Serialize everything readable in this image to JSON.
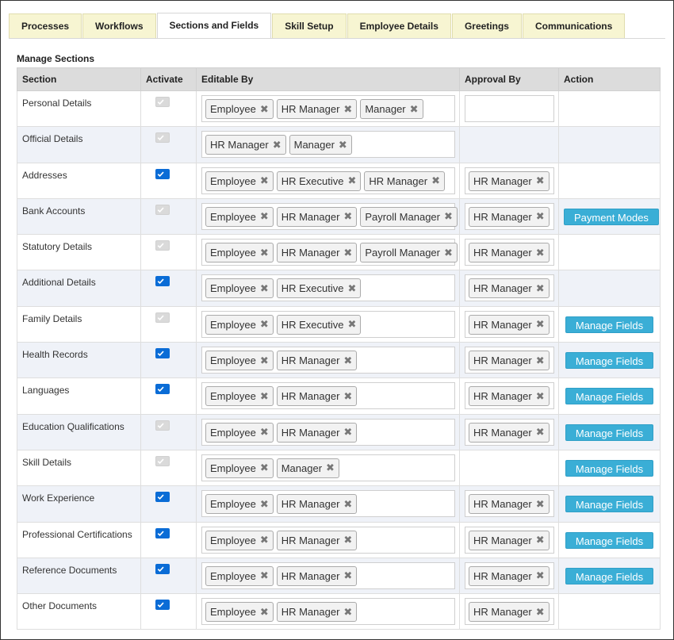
{
  "tabs": [
    {
      "label": "Processes",
      "active": false
    },
    {
      "label": "Workflows",
      "active": false
    },
    {
      "label": "Sections and Fields",
      "active": true
    },
    {
      "label": "Skill Setup",
      "active": false
    },
    {
      "label": "Employee Details",
      "active": false
    },
    {
      "label": "Greetings",
      "active": false
    },
    {
      "label": "Communications",
      "active": false
    }
  ],
  "manage_title": "Manage Sections",
  "columns": {
    "section": "Section",
    "activate": "Activate",
    "editable_by": "Editable By",
    "approval_by": "Approval By",
    "action": "Action"
  },
  "remove_glyph": "✖",
  "rows": [
    {
      "section": "Personal Details",
      "activate": "disabled",
      "editable_by": [
        "Employee",
        "HR Manager",
        "Manager"
      ],
      "approval_box": true,
      "approval_by": [],
      "action": ""
    },
    {
      "section": "Official Details",
      "activate": "disabled",
      "editable_by": [
        "HR Manager",
        "Manager"
      ],
      "approval_box": false,
      "approval_by": [],
      "action": ""
    },
    {
      "section": "Addresses",
      "activate": "checked",
      "editable_by": [
        "Employee",
        "HR Executive",
        "HR Manager"
      ],
      "approval_box": true,
      "approval_by": [
        "HR Manager"
      ],
      "action": ""
    },
    {
      "section": "Bank Accounts",
      "activate": "disabled",
      "editable_by": [
        "Employee",
        "HR Manager",
        "Payroll Manager"
      ],
      "approval_box": true,
      "approval_by": [
        "HR Manager"
      ],
      "action": "Payment Modes"
    },
    {
      "section": "Statutory Details",
      "activate": "disabled",
      "editable_by": [
        "Employee",
        "HR Manager",
        "Payroll Manager"
      ],
      "approval_box": true,
      "approval_by": [
        "HR Manager"
      ],
      "action": ""
    },
    {
      "section": "Additional Details",
      "activate": "checked",
      "editable_by": [
        "Employee",
        "HR Executive"
      ],
      "approval_box": true,
      "approval_by": [
        "HR Manager"
      ],
      "action": ""
    },
    {
      "section": "Family Details",
      "activate": "disabled",
      "editable_by": [
        "Employee",
        "HR Executive"
      ],
      "approval_box": true,
      "approval_by": [
        "HR Manager"
      ],
      "action": "Manage Fields"
    },
    {
      "section": "Health Records",
      "activate": "checked",
      "editable_by": [
        "Employee",
        "HR Manager"
      ],
      "approval_box": true,
      "approval_by": [
        "HR Manager"
      ],
      "action": "Manage Fields"
    },
    {
      "section": "Languages",
      "activate": "checked",
      "editable_by": [
        "Employee",
        "HR Manager"
      ],
      "approval_box": true,
      "approval_by": [
        "HR Manager"
      ],
      "action": "Manage Fields"
    },
    {
      "section": "Education Qualifications",
      "activate": "disabled",
      "editable_by": [
        "Employee",
        "HR Manager"
      ],
      "approval_box": true,
      "approval_by": [
        "HR Manager"
      ],
      "action": "Manage Fields"
    },
    {
      "section": "Skill Details",
      "activate": "disabled",
      "editable_by": [
        "Employee",
        "Manager"
      ],
      "approval_box": false,
      "approval_by": [],
      "action": "Manage Fields"
    },
    {
      "section": "Work Experience",
      "activate": "checked",
      "editable_by": [
        "Employee",
        "HR Manager"
      ],
      "approval_box": true,
      "approval_by": [
        "HR Manager"
      ],
      "action": "Manage Fields"
    },
    {
      "section": "Professional Certifications",
      "activate": "checked",
      "editable_by": [
        "Employee",
        "HR Manager"
      ],
      "approval_box": true,
      "approval_by": [
        "HR Manager"
      ],
      "action": "Manage Fields"
    },
    {
      "section": "Reference Documents",
      "activate": "checked",
      "editable_by": [
        "Employee",
        "HR Manager"
      ],
      "approval_box": true,
      "approval_by": [
        "HR Manager"
      ],
      "action": "Manage Fields"
    },
    {
      "section": "Other Documents",
      "activate": "checked",
      "editable_by": [
        "Employee",
        "HR Manager"
      ],
      "approval_box": true,
      "approval_by": [
        "HR Manager"
      ],
      "action": ""
    }
  ]
}
